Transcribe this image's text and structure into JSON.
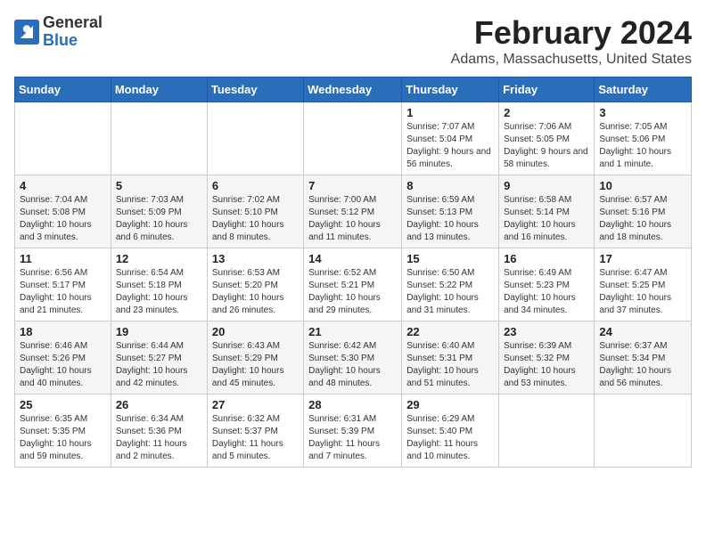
{
  "header": {
    "logo_general": "General",
    "logo_blue": "Blue",
    "month_year": "February 2024",
    "location": "Adams, Massachusetts, United States"
  },
  "days_of_week": [
    "Sunday",
    "Monday",
    "Tuesday",
    "Wednesday",
    "Thursday",
    "Friday",
    "Saturday"
  ],
  "weeks": [
    [
      {
        "day": "",
        "info": ""
      },
      {
        "day": "",
        "info": ""
      },
      {
        "day": "",
        "info": ""
      },
      {
        "day": "",
        "info": ""
      },
      {
        "day": "1",
        "info": "Sunrise: 7:07 AM\nSunset: 5:04 PM\nDaylight: 9 hours and 56 minutes."
      },
      {
        "day": "2",
        "info": "Sunrise: 7:06 AM\nSunset: 5:05 PM\nDaylight: 9 hours and 58 minutes."
      },
      {
        "day": "3",
        "info": "Sunrise: 7:05 AM\nSunset: 5:06 PM\nDaylight: 10 hours and 1 minute."
      }
    ],
    [
      {
        "day": "4",
        "info": "Sunrise: 7:04 AM\nSunset: 5:08 PM\nDaylight: 10 hours and 3 minutes."
      },
      {
        "day": "5",
        "info": "Sunrise: 7:03 AM\nSunset: 5:09 PM\nDaylight: 10 hours and 6 minutes."
      },
      {
        "day": "6",
        "info": "Sunrise: 7:02 AM\nSunset: 5:10 PM\nDaylight: 10 hours and 8 minutes."
      },
      {
        "day": "7",
        "info": "Sunrise: 7:00 AM\nSunset: 5:12 PM\nDaylight: 10 hours and 11 minutes."
      },
      {
        "day": "8",
        "info": "Sunrise: 6:59 AM\nSunset: 5:13 PM\nDaylight: 10 hours and 13 minutes."
      },
      {
        "day": "9",
        "info": "Sunrise: 6:58 AM\nSunset: 5:14 PM\nDaylight: 10 hours and 16 minutes."
      },
      {
        "day": "10",
        "info": "Sunrise: 6:57 AM\nSunset: 5:16 PM\nDaylight: 10 hours and 18 minutes."
      }
    ],
    [
      {
        "day": "11",
        "info": "Sunrise: 6:56 AM\nSunset: 5:17 PM\nDaylight: 10 hours and 21 minutes."
      },
      {
        "day": "12",
        "info": "Sunrise: 6:54 AM\nSunset: 5:18 PM\nDaylight: 10 hours and 23 minutes."
      },
      {
        "day": "13",
        "info": "Sunrise: 6:53 AM\nSunset: 5:20 PM\nDaylight: 10 hours and 26 minutes."
      },
      {
        "day": "14",
        "info": "Sunrise: 6:52 AM\nSunset: 5:21 PM\nDaylight: 10 hours and 29 minutes."
      },
      {
        "day": "15",
        "info": "Sunrise: 6:50 AM\nSunset: 5:22 PM\nDaylight: 10 hours and 31 minutes."
      },
      {
        "day": "16",
        "info": "Sunrise: 6:49 AM\nSunset: 5:23 PM\nDaylight: 10 hours and 34 minutes."
      },
      {
        "day": "17",
        "info": "Sunrise: 6:47 AM\nSunset: 5:25 PM\nDaylight: 10 hours and 37 minutes."
      }
    ],
    [
      {
        "day": "18",
        "info": "Sunrise: 6:46 AM\nSunset: 5:26 PM\nDaylight: 10 hours and 40 minutes."
      },
      {
        "day": "19",
        "info": "Sunrise: 6:44 AM\nSunset: 5:27 PM\nDaylight: 10 hours and 42 minutes."
      },
      {
        "day": "20",
        "info": "Sunrise: 6:43 AM\nSunset: 5:29 PM\nDaylight: 10 hours and 45 minutes."
      },
      {
        "day": "21",
        "info": "Sunrise: 6:42 AM\nSunset: 5:30 PM\nDaylight: 10 hours and 48 minutes."
      },
      {
        "day": "22",
        "info": "Sunrise: 6:40 AM\nSunset: 5:31 PM\nDaylight: 10 hours and 51 minutes."
      },
      {
        "day": "23",
        "info": "Sunrise: 6:39 AM\nSunset: 5:32 PM\nDaylight: 10 hours and 53 minutes."
      },
      {
        "day": "24",
        "info": "Sunrise: 6:37 AM\nSunset: 5:34 PM\nDaylight: 10 hours and 56 minutes."
      }
    ],
    [
      {
        "day": "25",
        "info": "Sunrise: 6:35 AM\nSunset: 5:35 PM\nDaylight: 10 hours and 59 minutes."
      },
      {
        "day": "26",
        "info": "Sunrise: 6:34 AM\nSunset: 5:36 PM\nDaylight: 11 hours and 2 minutes."
      },
      {
        "day": "27",
        "info": "Sunrise: 6:32 AM\nSunset: 5:37 PM\nDaylight: 11 hours and 5 minutes."
      },
      {
        "day": "28",
        "info": "Sunrise: 6:31 AM\nSunset: 5:39 PM\nDaylight: 11 hours and 7 minutes."
      },
      {
        "day": "29",
        "info": "Sunrise: 6:29 AM\nSunset: 5:40 PM\nDaylight: 11 hours and 10 minutes."
      },
      {
        "day": "",
        "info": ""
      },
      {
        "day": "",
        "info": ""
      }
    ]
  ]
}
